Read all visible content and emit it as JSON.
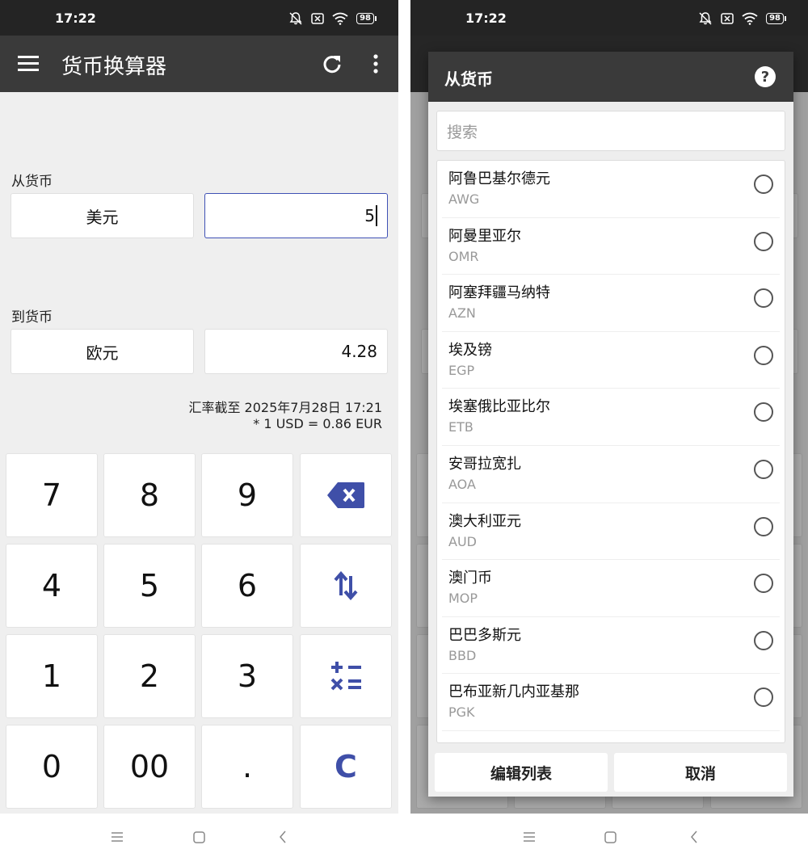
{
  "status": {
    "time": "17:22",
    "battery": "98"
  },
  "converter": {
    "title": "货币换算器",
    "from_label": "从货币",
    "from_currency": "美元",
    "from_amount": "5",
    "to_label": "到货币",
    "to_currency": "欧元",
    "to_amount": "4.28",
    "rate_date": "汇率截至 2025年7月28日 17:21",
    "rate_formula": "* 1 USD = 0.86 EUR"
  },
  "keypad": {
    "k7": "7",
    "k8": "8",
    "k9": "9",
    "k4": "4",
    "k5": "5",
    "k6": "6",
    "k1": "1",
    "k2": "2",
    "k3": "3",
    "k0": "0",
    "k00": "00",
    "kdot": ".",
    "kclear": "C"
  },
  "dialog": {
    "title": "从货币",
    "help": "?",
    "search_placeholder": "搜索",
    "edit_button": "编辑列表",
    "cancel_button": "取消",
    "currencies": [
      {
        "name": "阿鲁巴基尔德元",
        "code": "AWG"
      },
      {
        "name": "阿曼里亚尔",
        "code": "OMR"
      },
      {
        "name": "阿塞拜疆马纳特",
        "code": "AZN"
      },
      {
        "name": "埃及镑",
        "code": "EGP"
      },
      {
        "name": "埃塞俄比亚比尔",
        "code": "ETB"
      },
      {
        "name": "安哥拉宽扎",
        "code": "AOA"
      },
      {
        "name": "澳大利亚元",
        "code": "AUD"
      },
      {
        "name": "澳门币",
        "code": "MOP"
      },
      {
        "name": "巴巴多斯元",
        "code": "BBD"
      },
      {
        "name": "巴布亚新几内亚基那",
        "code": "PGK"
      }
    ]
  },
  "colors": {
    "appbar": "#3a3a3a",
    "statusbar": "#242424",
    "accent": "#3f4fa8",
    "background": "#efefef"
  }
}
